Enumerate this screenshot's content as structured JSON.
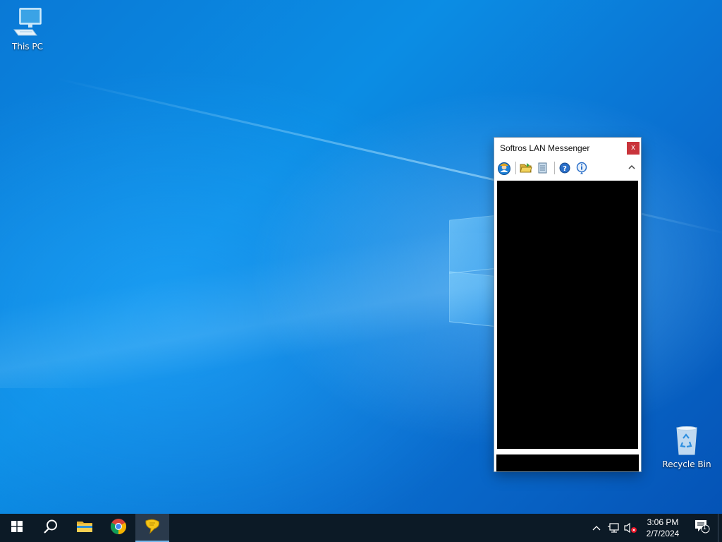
{
  "desktop": {
    "icons": [
      {
        "label": "This PC",
        "icon": "computer-icon"
      },
      {
        "label": "Recycle Bin",
        "icon": "recycle-bin-icon"
      }
    ]
  },
  "messenger": {
    "title": "Softros LAN Messenger",
    "close_label": "x",
    "toolbar": [
      {
        "name": "status",
        "icon": "user-status-icon"
      },
      {
        "name": "open-folder",
        "icon": "folder-open-icon"
      },
      {
        "name": "message-history",
        "icon": "history-icon"
      },
      {
        "name": "help",
        "icon": "help-icon"
      },
      {
        "name": "about",
        "icon": "info-icon"
      }
    ],
    "collapse_icon": "chevron-up-icon"
  },
  "taskbar": {
    "apps": [
      {
        "name": "start",
        "icon": "windows-start-icon"
      },
      {
        "name": "search",
        "icon": "search-icon"
      },
      {
        "name": "file-explorer",
        "icon": "folder-icon"
      },
      {
        "name": "chrome",
        "icon": "chrome-icon"
      },
      {
        "name": "softros-messenger",
        "icon": "chat-bubble-icon",
        "active": true
      }
    ],
    "tray": {
      "icons": [
        "chevron-up-icon",
        "network-icon",
        "volume-muted-icon"
      ],
      "time": "3:06 PM",
      "date": "2/7/2024",
      "notification_count": "1"
    }
  },
  "colors": {
    "taskbar_bg": "#0c1a26",
    "close_button": "#c9343b",
    "active_underline": "#76b9ed"
  }
}
